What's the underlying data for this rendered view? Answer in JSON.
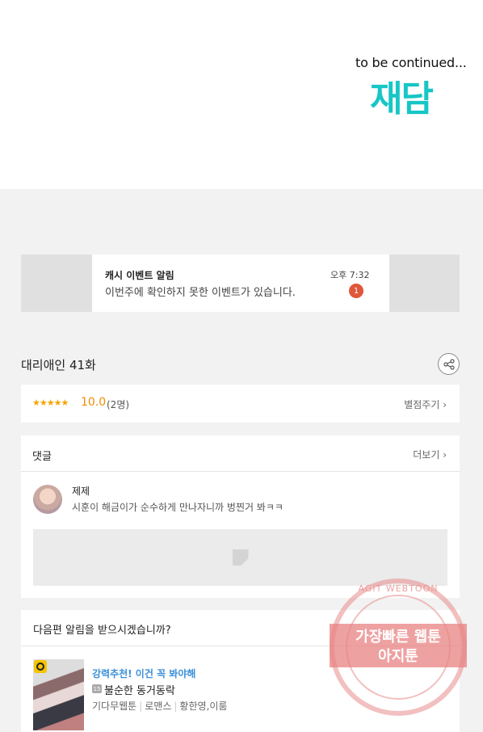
{
  "header": {
    "tagline": "to be continued...",
    "brand": "재담"
  },
  "notification": {
    "title": "캐시 이벤트 알림",
    "time": "오후 7:32",
    "message": "이번주에 확인하지 못한 이벤트가 있습니다.",
    "badge": "1"
  },
  "episode": {
    "title": "대리애인 41화"
  },
  "rating": {
    "stars": "★★★★★",
    "score": "10.0",
    "count": "(2명)",
    "rate_link": "별점주기 ›"
  },
  "comments": {
    "title": "댓글",
    "more": "더보기 ›",
    "items": [
      {
        "user": "제제",
        "text": "시훈이 해금이가 순수하게 만나자니까 벙찐거 봐ㅋㅋ"
      }
    ]
  },
  "next": {
    "question": "다음편 알림을 받으시겠습니까?",
    "recommend_label": "강력추천! 이건 꼭 봐야해",
    "age_badge": "15",
    "title": "불순한 동거동락",
    "meta": [
      "기다무웹툰",
      "로맨스",
      "황한영,이룸"
    ]
  },
  "watermark": {
    "top": "AGIT WEBTOON",
    "line1": "가장빠른 웹툰",
    "line2": "아지툰"
  }
}
